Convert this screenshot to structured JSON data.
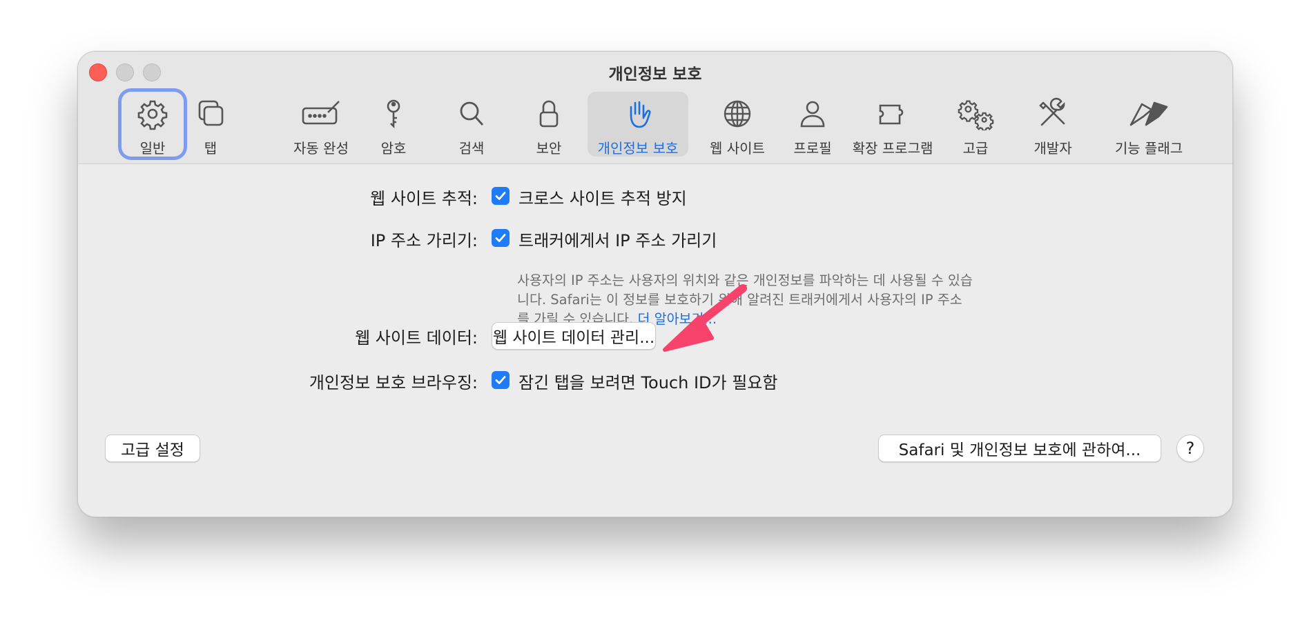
{
  "window": {
    "title": "개인정보 보호"
  },
  "tabs": [
    {
      "label": "일반",
      "icon": "gear-icon"
    },
    {
      "label": "탭",
      "icon": "tabs-icon"
    },
    {
      "label": "자동 완성",
      "icon": "autofill-pencil-icon"
    },
    {
      "label": "암호",
      "icon": "key-icon"
    },
    {
      "label": "검색",
      "icon": "magnifier-icon"
    },
    {
      "label": "보안",
      "icon": "lock-icon"
    },
    {
      "label": "개인정보 보호",
      "icon": "hand-icon"
    },
    {
      "label": "웹 사이트",
      "icon": "globe-icon"
    },
    {
      "label": "프로필",
      "icon": "person-icon"
    },
    {
      "label": "확장 프로그램",
      "icon": "puzzle-icon"
    },
    {
      "label": "고급",
      "icon": "gears-icon"
    },
    {
      "label": "개발자",
      "icon": "tools-icon"
    },
    {
      "label": "기능 플래그",
      "icon": "flags-icon"
    }
  ],
  "rows": {
    "tracking": {
      "label": "웹 사이트 추적:",
      "checkbox_text": "크로스 사이트 추적 방지",
      "checked": true
    },
    "ip": {
      "label": "IP 주소 가리기:",
      "checkbox_text": "트래커에게서 IP 주소 가리기",
      "checked": true,
      "description_line1": "사용자의 IP 주소는 사용자의 위치와 같은 개인정보를 파악하는 데 사용될 수 있습",
      "description_line2": "니다. Safari는 이 정보를 보호하기 위해 알려진 트래커에게서 사용자의 IP 주소",
      "description_line3": "를 가릴 수 있습니다.",
      "learn_more": "더 알아보기..."
    },
    "website_data": {
      "label": "웹 사이트 데이터:",
      "button": "웹 사이트 데이터 관리..."
    },
    "private_browsing": {
      "label": "개인정보 보호 브라우징:",
      "checkbox_text": "잠긴 탭을 보려면 Touch ID가 필요함",
      "checked": true
    }
  },
  "footer": {
    "advanced_button": "고급 설정",
    "about_button": "Safari 및 개인정보 보호에 관하여...",
    "help_button": "?"
  },
  "colors": {
    "accent": "#1f7cf6",
    "link": "#1a6fe0",
    "arrow": "#f7426b",
    "close": "#ff5f57"
  }
}
